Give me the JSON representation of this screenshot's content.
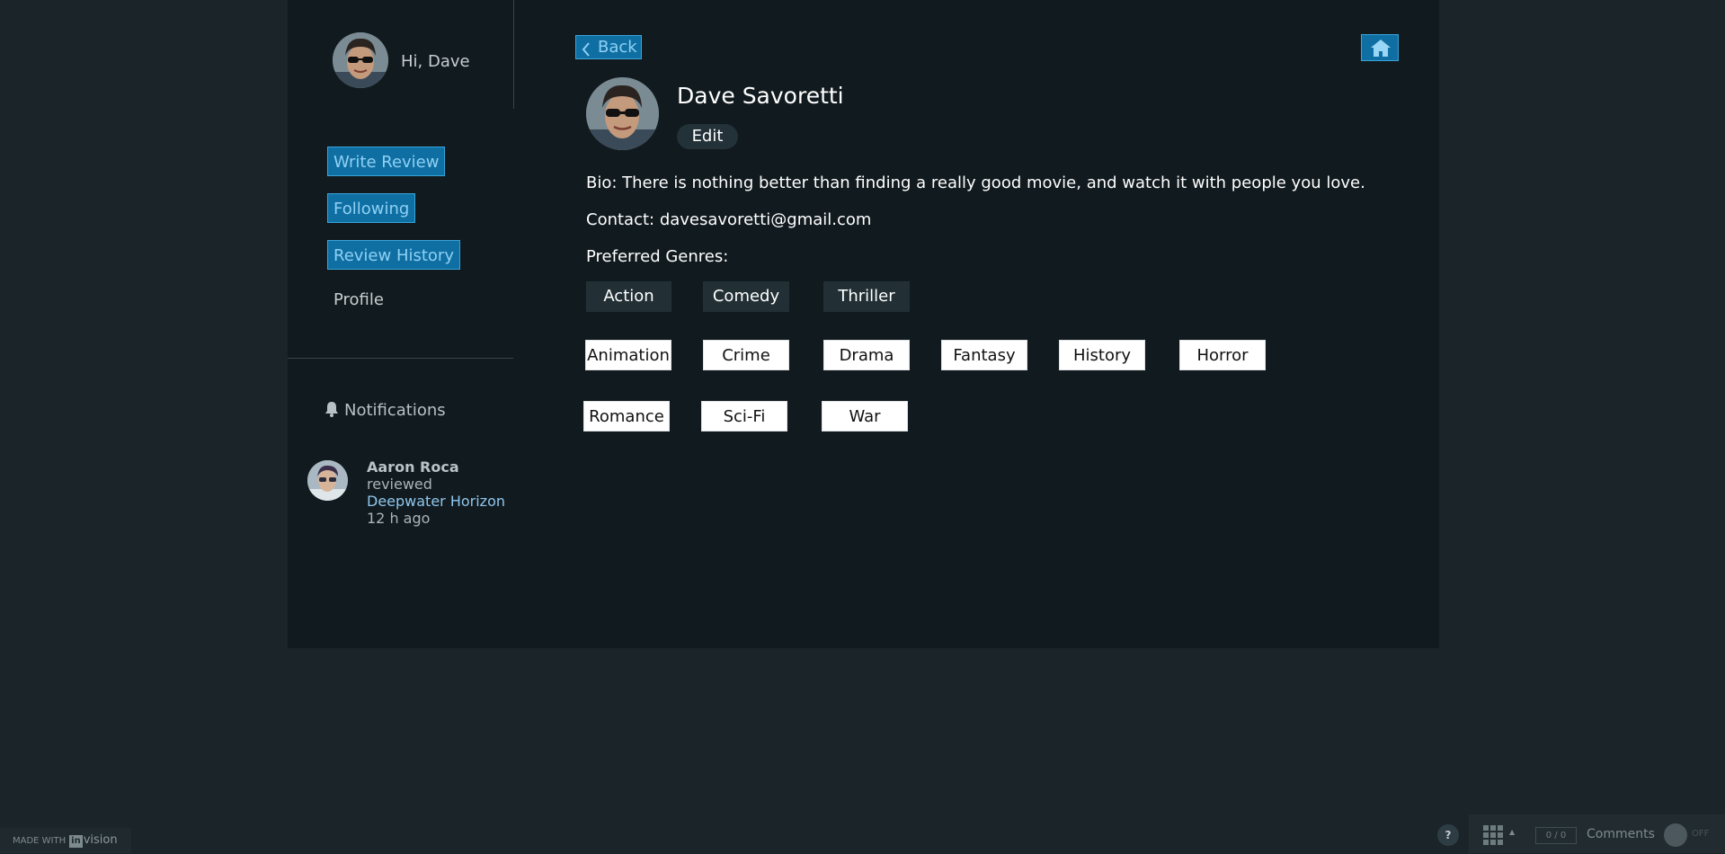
{
  "sidebar": {
    "greeting": "Hi, Dave",
    "nav": [
      {
        "label": "Write Review"
      },
      {
        "label": "Following"
      },
      {
        "label": "Review History"
      }
    ],
    "profile_label": "Profile",
    "notifications": {
      "heading": "Notifications",
      "items": [
        {
          "name": "Aaron Roca",
          "action": "reviewed",
          "film": "Deepwater Horizon",
          "time": "12 h ago"
        }
      ]
    }
  },
  "toolbar": {
    "back_label": "Back",
    "home_icon": "home-icon"
  },
  "profile": {
    "name": "Dave Savoretti",
    "edit_label": "Edit",
    "bio": "Bio: There is nothing better than finding a really good movie, and watch it with people you love.",
    "contact": "Contact: davesavoretti@gmail.com",
    "genres_label": "Preferred Genres:"
  },
  "genres": {
    "selected": [
      "Action",
      "Comedy",
      "Thriller"
    ],
    "available": [
      "Animation",
      "Crime",
      "Drama",
      "Fantasy",
      "History",
      "Horror",
      "Romance",
      "Sci-Fi",
      "War"
    ]
  },
  "footer": {
    "made_with": "MADE WITH",
    "brand_in": "in",
    "brand_vision": "vision",
    "help": "?",
    "counter": "0 / 0",
    "comments": "Comments",
    "toggle": "OFF"
  },
  "colors": {
    "accent": "#0f6fa3",
    "accent_border": "#39a4da",
    "panel": "#111a1e",
    "page": "#1b2529"
  }
}
